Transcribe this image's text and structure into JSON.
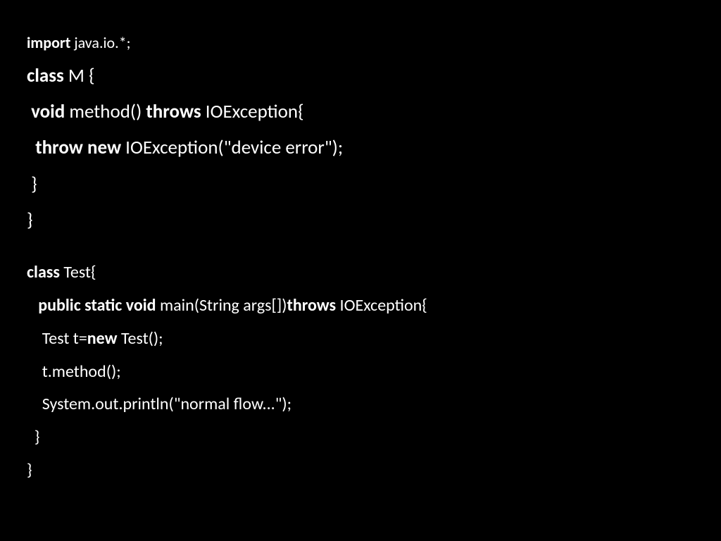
{
  "block1": {
    "l1": {
      "a": "import",
      "b": " java.io.*;"
    },
    "l2": {
      "a": "class",
      "b": " M {"
    },
    "l3": {
      "a": " void",
      "b": " method() ",
      "c": "throws",
      "d": " IOException{"
    },
    "l4": {
      "a": "  throw new",
      "b": " IOException(\"device error\");"
    },
    "l5": " }",
    "l6": "}"
  },
  "block2": {
    "l1": {
      "a": "class",
      "b": " Test{"
    },
    "l2": {
      "a": "   public static void",
      "b": " main(String args[])",
      "c": "throws",
      "d": " IOException{"
    },
    "l3": {
      "a": "    Test t=",
      "b": "new",
      "c": " Test();"
    },
    "l4": "    t.method();",
    "l5": "    System.out.println(\"normal flow...\");",
    "l6": "  }",
    "l7": "}"
  }
}
